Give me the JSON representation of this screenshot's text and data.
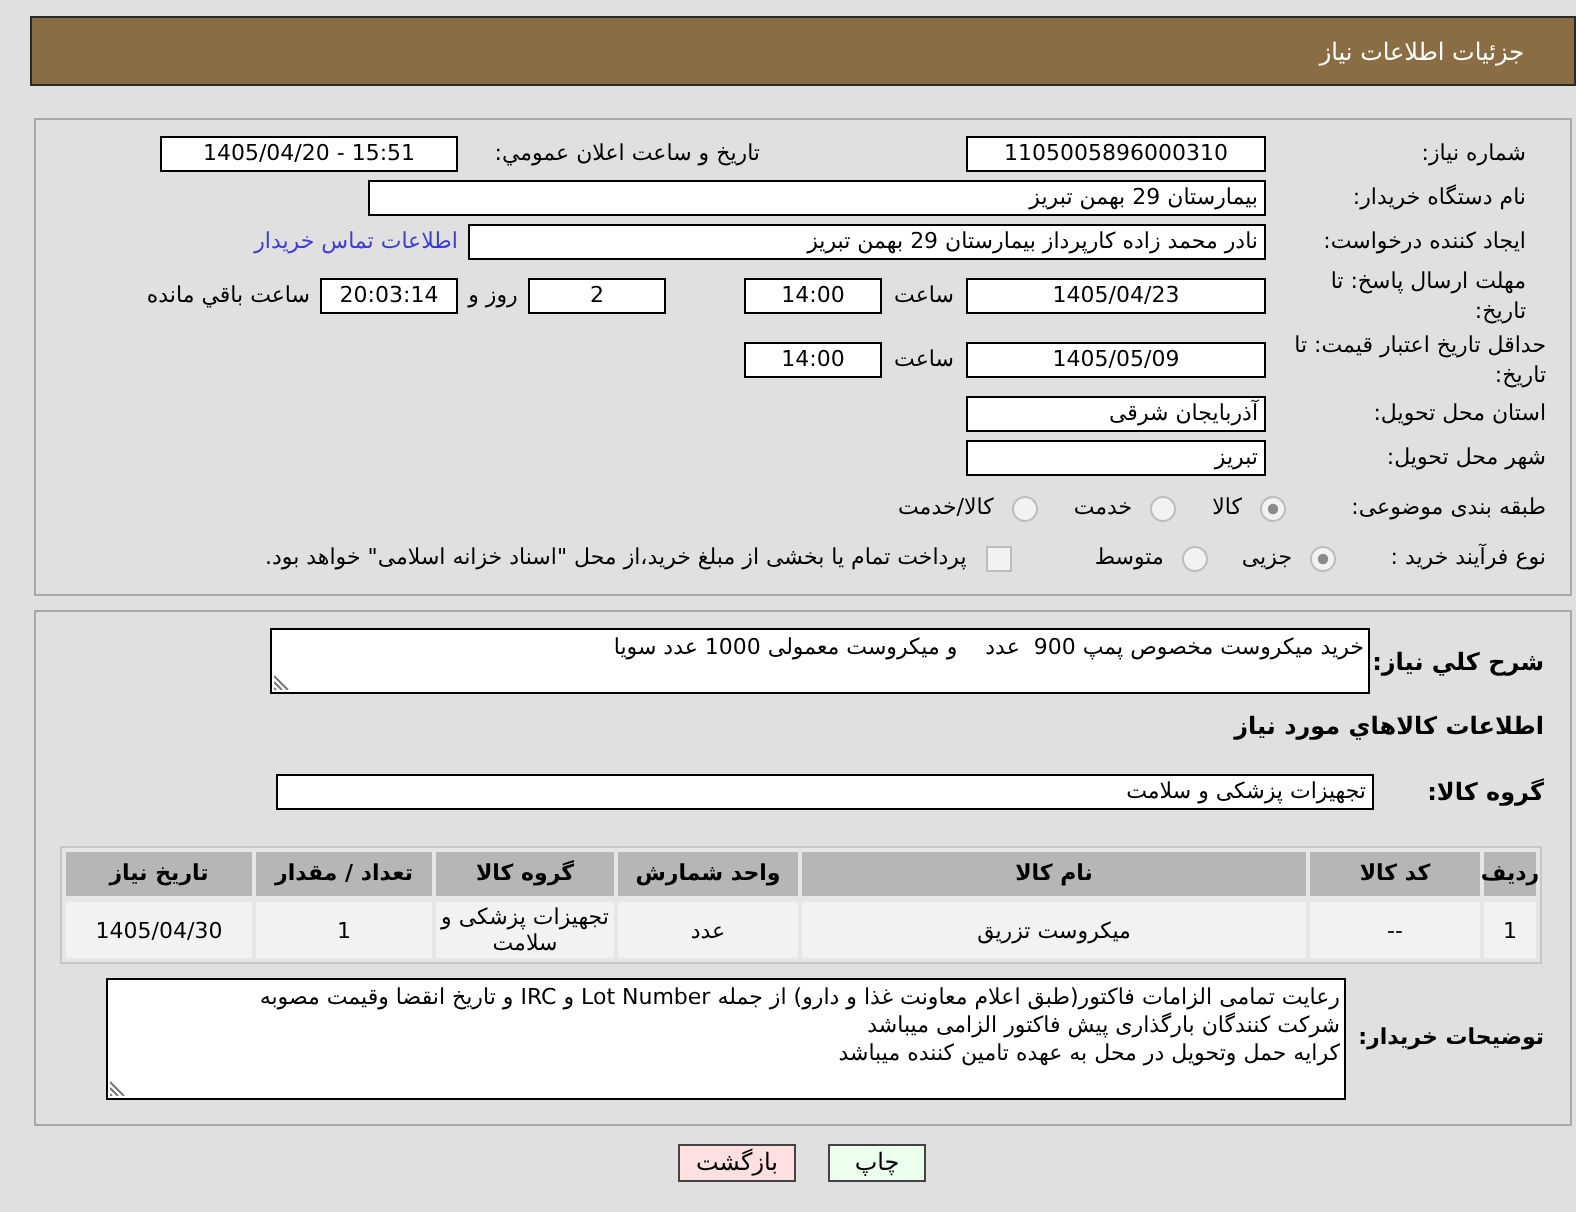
{
  "header": {
    "title": "جزئیات اطلاعات نیاز"
  },
  "details": {
    "need_number": {
      "label": "شماره نیاز:",
      "value": "1105005896000310"
    },
    "announce_datetime": {
      "label": "تاریخ و ساعت اعلان عمومي:",
      "value": "1405/04/20 - 15:51"
    },
    "buyer_org": {
      "label": "نام دستگاه خریدار:",
      "value": "بیمارستان 29 بهمن تبریز"
    },
    "requester": {
      "label": "ایجاد کننده درخواست:",
      "value": "نادر محمد زاده کارپرداز بیمارستان 29 بهمن تبریز",
      "link": "اطلاعات تماس خریدار"
    },
    "response_deadline": {
      "label": "مهلت ارسال پاسخ: تا تاریخ:",
      "date": "1405/04/23",
      "time_label": "ساعت",
      "time": "14:00",
      "days": "2",
      "days_label": "روز و",
      "remaining": "20:03:14",
      "remaining_label": "ساعت باقي مانده"
    },
    "price_validity": {
      "label": "حداقل تاریخ اعتبار قیمت: تا تاریخ:",
      "date": "1405/05/09",
      "time_label": "ساعت",
      "time": "14:00"
    },
    "province": {
      "label": "استان محل تحویل:",
      "value": "آذربایجان شرقی"
    },
    "city": {
      "label": "شهر محل تحویل:",
      "value": "تبریز"
    },
    "category": {
      "label": "طبقه بندی موضوعی:",
      "options": [
        {
          "label": "کالا",
          "selected": true
        },
        {
          "label": "خدمت",
          "selected": false
        },
        {
          "label": "کالا/خدمت",
          "selected": false
        }
      ]
    },
    "purchase_type": {
      "label": "نوع فرآیند خرید :",
      "options": [
        {
          "label": "جزیی",
          "selected": true
        },
        {
          "label": "متوسط",
          "selected": false
        }
      ],
      "treasury": {
        "label": "پرداخت تمام یا بخشی از مبلغ خرید،از محل \"اسناد خزانه اسلامی\" خواهد بود.",
        "checked": false
      }
    }
  },
  "description": {
    "label": "شرح کلي نیاز:",
    "value": "خرید میکروست مخصوص پمپ 900  عدد    و میکروست معمولی 1000 عدد سویا"
  },
  "goods": {
    "title": "اطلاعات کالاهاي مورد نیاز",
    "group": {
      "label": "گروه کالا:",
      "value": "تجهیزات پزشکی و سلامت"
    },
    "table": {
      "columns": [
        "ردیف",
        "کد کالا",
        "نام کالا",
        "واحد شمارش",
        "گروه کالا",
        "تعداد / مقدار",
        "تاریخ نیاز"
      ],
      "rows": [
        [
          "1",
          "--",
          "میکروست تزریق",
          "عدد",
          "تجهیزات پزشکی و سلامت",
          "1",
          "1405/04/30"
        ]
      ]
    }
  },
  "buyer_notes": {
    "label": "توضیحات خریدار:",
    "value": "رعایت تمامی الزامات فاکتور(طبق اعلام معاونت غذا و دارو) از جمله Lot Number و IRC و تاریخ انقضا وقیمت مصوبه\nشرکت کنندگان بارگذاری پیش فاکتور الزامی میباشد\nکرایه حمل وتحویل در محل به عهده تامین کننده میباشد"
  },
  "buttons": [
    {
      "label": "چاپ",
      "kind": "print"
    },
    {
      "label": "بازگشت",
      "kind": "back"
    }
  ]
}
